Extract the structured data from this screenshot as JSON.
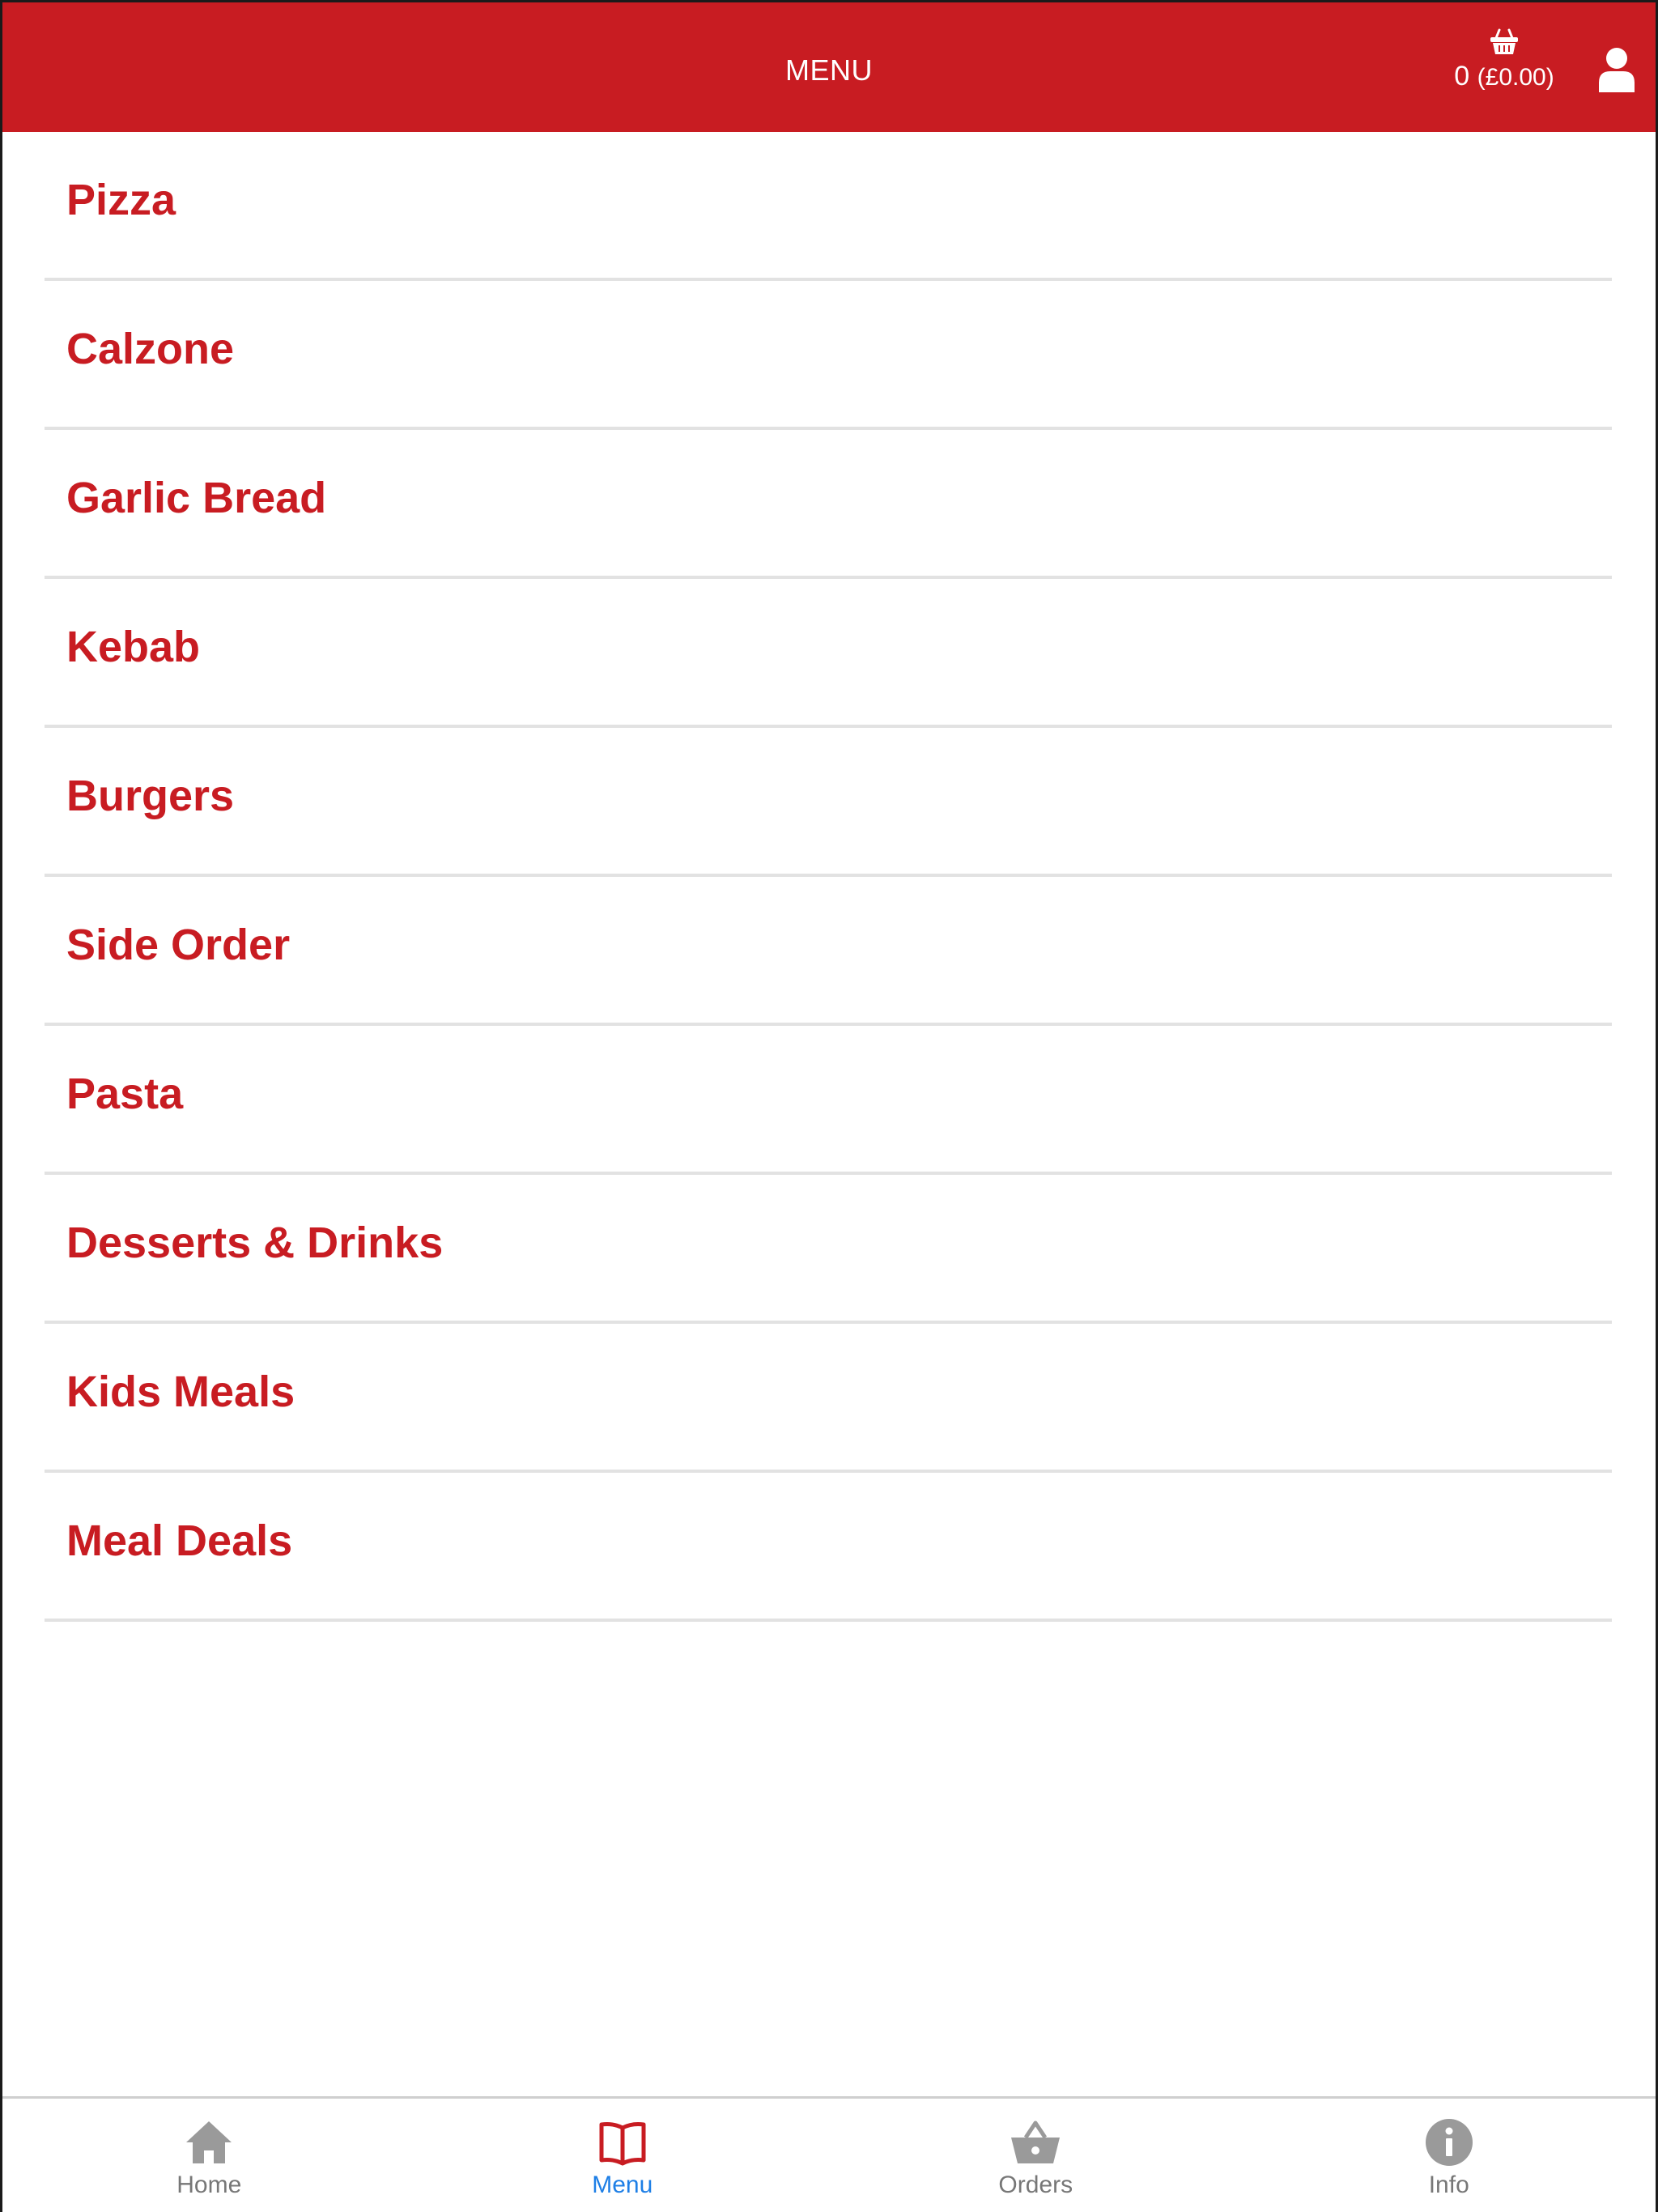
{
  "header": {
    "title": "MENU",
    "cart_count": "0",
    "cart_total": "(£0.00)"
  },
  "menu": {
    "categories": [
      {
        "label": "Pizza"
      },
      {
        "label": "Calzone"
      },
      {
        "label": "Garlic Bread"
      },
      {
        "label": "Kebab"
      },
      {
        "label": "Burgers"
      },
      {
        "label": "Side Order"
      },
      {
        "label": "Pasta"
      },
      {
        "label": "Desserts & Drinks"
      },
      {
        "label": "Kids Meals"
      },
      {
        "label": "Meal Deals"
      }
    ]
  },
  "bottom_nav": {
    "items": [
      {
        "label": "Home",
        "icon": "home-icon"
      },
      {
        "label": "Menu",
        "icon": "book-icon",
        "active": true
      },
      {
        "label": "Orders",
        "icon": "basket-icon"
      },
      {
        "label": "Info",
        "icon": "info-icon"
      }
    ]
  },
  "colors": {
    "brand_red": "#c81c22",
    "active_blue": "#1e7fe6",
    "inactive_gray": "#777777",
    "divider": "#e2e2e2"
  }
}
